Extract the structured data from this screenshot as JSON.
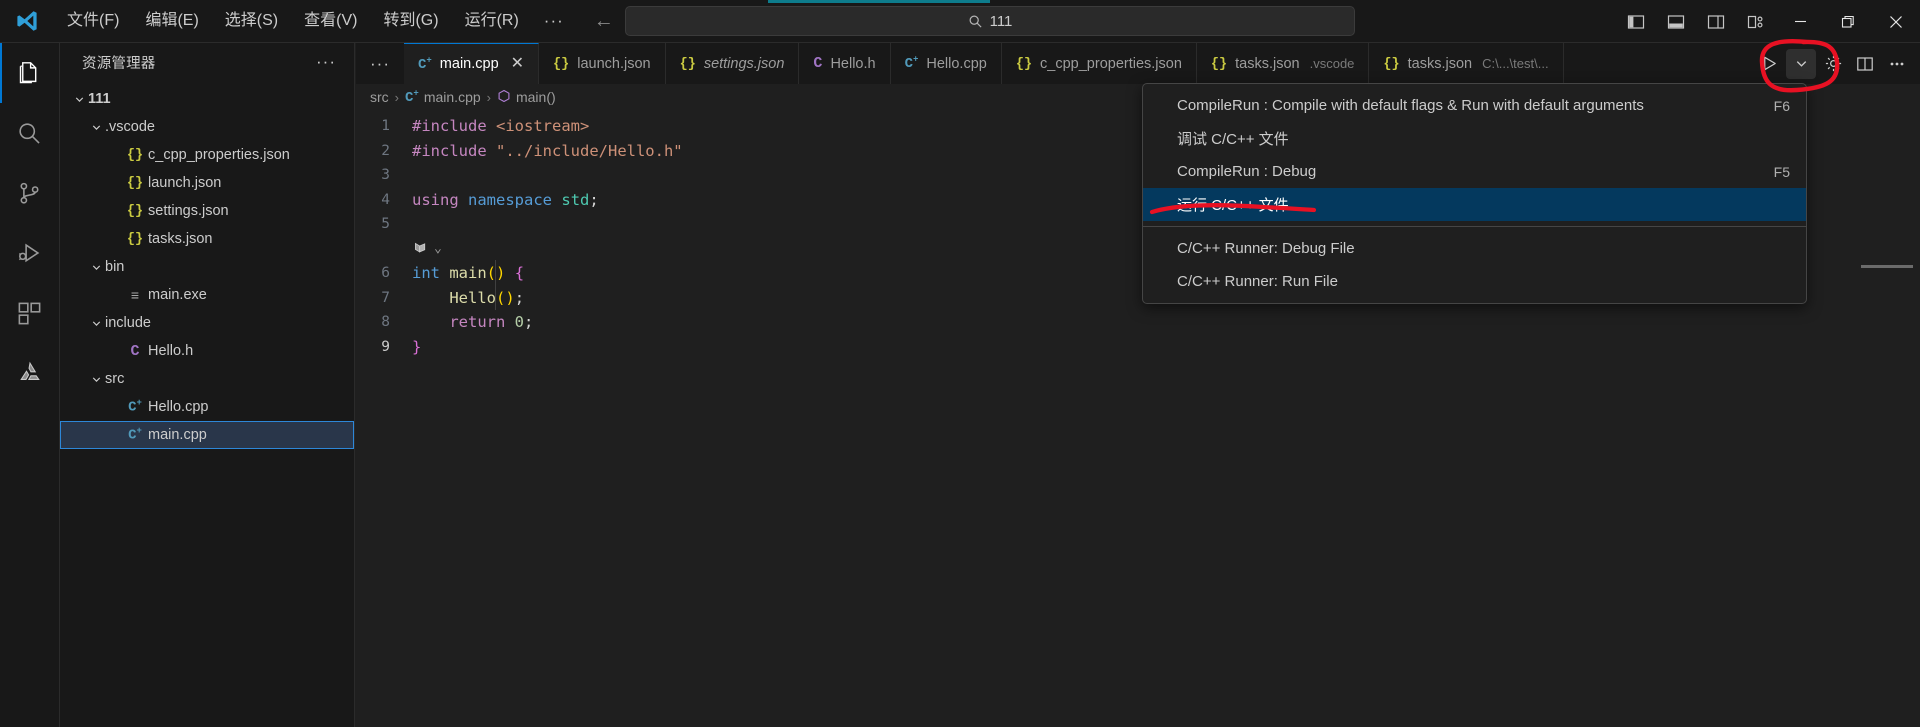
{
  "window": {
    "title_icon": "vscode-logo",
    "menus": [
      "文件(F)",
      "编辑(E)",
      "选择(S)",
      "查看(V)",
      "转到(G)",
      "运行(R)"
    ],
    "overflow_label": "···",
    "nav_back": "←",
    "nav_forward": "→",
    "search": {
      "value": "111",
      "icon": "search-icon"
    },
    "layout_icons": [
      "toggle-primary-sidebar-icon",
      "toggle-panel-icon",
      "toggle-secondary-sidebar-icon",
      "customize-layout-icon"
    ],
    "controls": {
      "minimize": "—",
      "maximize": "❐",
      "close": "✕"
    },
    "progress_color": "#0d7c8c"
  },
  "activity_bar": {
    "items": [
      {
        "name": "explorer",
        "icon": "files-icon",
        "active": true
      },
      {
        "name": "search",
        "icon": "search-icon",
        "active": false
      },
      {
        "name": "source-control",
        "icon": "source-control-icon",
        "active": false
      },
      {
        "name": "run-and-debug",
        "icon": "run-debug-icon",
        "active": false
      },
      {
        "name": "extensions",
        "icon": "extensions-icon",
        "active": false
      },
      {
        "name": "custom-extension",
        "icon": "recycle-logo-icon",
        "active": false
      }
    ]
  },
  "sidebar": {
    "title": "资源管理器",
    "more_actions": "···",
    "tree": [
      {
        "label": "111",
        "indent": 0,
        "icon": "none",
        "chevron": "down",
        "bold": true,
        "selected": false
      },
      {
        "label": ".vscode",
        "indent": 1,
        "icon": "none",
        "chevron": "down",
        "bold": false,
        "selected": false
      },
      {
        "label": "c_cpp_properties.json",
        "indent": 2,
        "icon": "json",
        "chevron": "none",
        "bold": false,
        "selected": false
      },
      {
        "label": "launch.json",
        "indent": 2,
        "icon": "json",
        "chevron": "none",
        "bold": false,
        "selected": false
      },
      {
        "label": "settings.json",
        "indent": 2,
        "icon": "json",
        "chevron": "none",
        "bold": false,
        "selected": false
      },
      {
        "label": "tasks.json",
        "indent": 2,
        "icon": "json",
        "chevron": "none",
        "bold": false,
        "selected": false
      },
      {
        "label": "bin",
        "indent": 1,
        "icon": "none",
        "chevron": "down",
        "bold": false,
        "selected": false
      },
      {
        "label": "main.exe",
        "indent": 2,
        "icon": "exe",
        "chevron": "none",
        "bold": false,
        "selected": false
      },
      {
        "label": "include",
        "indent": 1,
        "icon": "none",
        "chevron": "down",
        "bold": false,
        "selected": false
      },
      {
        "label": "Hello.h",
        "indent": 2,
        "icon": "header",
        "chevron": "none",
        "bold": false,
        "selected": false
      },
      {
        "label": "src",
        "indent": 1,
        "icon": "none",
        "chevron": "down",
        "bold": false,
        "selected": false
      },
      {
        "label": "Hello.cpp",
        "indent": 2,
        "icon": "cpp",
        "chevron": "none",
        "bold": false,
        "selected": false
      },
      {
        "label": "main.cpp",
        "indent": 2,
        "icon": "cpp",
        "chevron": "none",
        "bold": false,
        "selected": true
      }
    ]
  },
  "tabs": {
    "overflow": "···",
    "items": [
      {
        "name": "main.cpp",
        "path": "",
        "icon": "cpp",
        "active": true,
        "italic": false,
        "closable": true
      },
      {
        "name": "launch.json",
        "path": "",
        "icon": "json",
        "active": false,
        "italic": false,
        "closable": false
      },
      {
        "name": "settings.json",
        "path": "",
        "icon": "json",
        "active": false,
        "italic": true,
        "closable": false
      },
      {
        "name": "Hello.h",
        "path": "",
        "icon": "header",
        "active": false,
        "italic": false,
        "closable": false
      },
      {
        "name": "Hello.cpp",
        "path": "",
        "icon": "cpp",
        "active": false,
        "italic": false,
        "closable": false
      },
      {
        "name": "c_cpp_properties.json",
        "path": "",
        "icon": "json",
        "active": false,
        "italic": false,
        "closable": false
      },
      {
        "name": "tasks.json",
        "path": ".vscode",
        "icon": "json",
        "active": false,
        "italic": false,
        "closable": false
      },
      {
        "name": "tasks.json",
        "path": "C:\\...\\test\\...",
        "icon": "json",
        "active": false,
        "italic": false,
        "closable": false
      }
    ],
    "actions": [
      "run-button",
      "run-dropdown-chevron",
      "settings-gear",
      "split-editor",
      "more-actions"
    ]
  },
  "breadcrumb": {
    "parts": [
      {
        "label": "src",
        "icon": "none"
      },
      {
        "label": "main.cpp",
        "icon": "cpp"
      },
      {
        "label": "main()",
        "icon": "symbol-method"
      }
    ],
    "separator": "›"
  },
  "editor": {
    "lines": [
      {
        "num": "1",
        "tokens": [
          {
            "t": "#include ",
            "c": "k-pink"
          },
          {
            "t": "<iostream>",
            "c": "k-orange"
          }
        ]
      },
      {
        "num": "2",
        "tokens": [
          {
            "t": "#include ",
            "c": "k-pink"
          },
          {
            "t": "\"../include/Hello.h\"",
            "c": "k-orange"
          }
        ]
      },
      {
        "num": "3",
        "tokens": []
      },
      {
        "num": "4",
        "tokens": [
          {
            "t": "using",
            "c": "k-pink"
          },
          {
            "t": " ",
            "c": "k-white"
          },
          {
            "t": "namespace",
            "c": "k-blue"
          },
          {
            "t": " ",
            "c": "k-white"
          },
          {
            "t": "std",
            "c": "k-green"
          },
          {
            "t": ";",
            "c": "k-white"
          }
        ]
      },
      {
        "num": "5",
        "tokens": []
      },
      {
        "num": "6",
        "tokens": [
          {
            "t": "int",
            "c": "k-blue"
          },
          {
            "t": " ",
            "c": "k-white"
          },
          {
            "t": "main",
            "c": "k-yellow"
          },
          {
            "t": "(",
            "c": "k-brack"
          },
          {
            "t": ")",
            "c": "k-brack"
          },
          {
            "t": " ",
            "c": "k-white"
          },
          {
            "t": "{",
            "c": "k-purple"
          }
        ]
      },
      {
        "num": "7",
        "tokens": [
          {
            "t": "    ",
            "c": "k-white"
          },
          {
            "t": "Hello",
            "c": "k-yellow"
          },
          {
            "t": "(",
            "c": "k-brack"
          },
          {
            "t": ")",
            "c": "k-brack"
          },
          {
            "t": ";",
            "c": "k-white"
          }
        ]
      },
      {
        "num": "8",
        "tokens": [
          {
            "t": "    ",
            "c": "k-white"
          },
          {
            "t": "return",
            "c": "k-pink"
          },
          {
            "t": " ",
            "c": "k-white"
          },
          {
            "t": "0",
            "c": "k-num"
          },
          {
            "t": ";",
            "c": "k-white"
          }
        ]
      },
      {
        "num": "9",
        "tokens": [
          {
            "t": "}",
            "c": "k-purple"
          }
        ]
      }
    ],
    "codelens": {
      "icon": "run-codelens-icon",
      "chevron": "⌄"
    }
  },
  "dropdown": {
    "items": [
      {
        "label": "CompileRun : Compile with default flags & Run with default arguments",
        "key": "F6",
        "selected": false,
        "separator_after": false
      },
      {
        "label": "调试 C/C++ 文件",
        "key": "",
        "selected": false,
        "separator_after": false
      },
      {
        "label": "CompileRun : Debug",
        "key": "F5",
        "selected": false,
        "separator_after": false
      },
      {
        "label": "运行 C/C++ 文件",
        "key": "",
        "selected": true,
        "separator_after": true
      },
      {
        "label": "C/C++ Runner: Debug File",
        "key": "",
        "selected": false,
        "separator_after": false
      },
      {
        "label": "C/C++ Runner: Run File",
        "key": "",
        "selected": false,
        "separator_after": false
      }
    ],
    "highlight_color": "#04395e"
  },
  "annotations": {
    "color": "#e81123",
    "shapes": [
      "circle-around-run-button",
      "underline-under-selected-menu-item"
    ]
  }
}
